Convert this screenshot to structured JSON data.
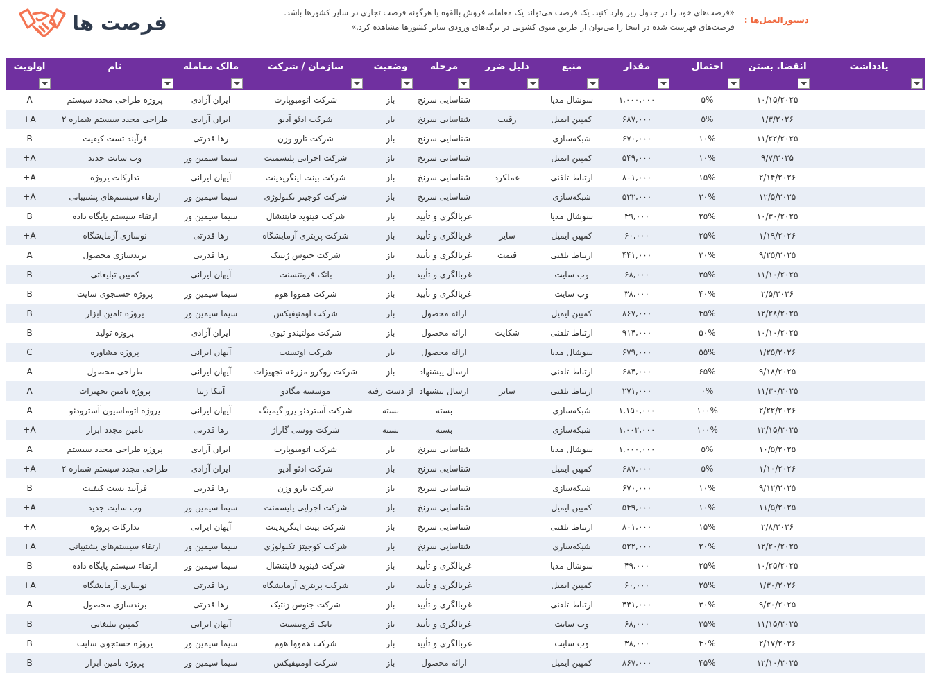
{
  "header": {
    "title": "فرصت ها",
    "instructions_label": "دستورالعمل‌ها :",
    "instruction_lines": [
      "«فرصت‌های خود را در جدول زیر وارد کنید. یک فرصت می‌تواند یک معامله، فروش بالقوه یا هرگونه فرصت تجاری در سایر کشورها باشد.",
      "فرصت‌های فهرست شده در اینجا را می‌توان از طریق منوی کشویی در برگه‌های ورودی سایر کشورها مشاهده کرد.»"
    ]
  },
  "table": {
    "columns": [
      {
        "label": "یادداشت"
      },
      {
        "label": "انقضا. بستن"
      },
      {
        "label": "احتمال"
      },
      {
        "label": "مقدار"
      },
      {
        "label": "منبع"
      },
      {
        "label": "دلیل ضرر"
      },
      {
        "label": "مرحله"
      },
      {
        "label": "وضعیت"
      },
      {
        "label": "سازمان / شرکت"
      },
      {
        "label": "مالک معامله"
      },
      {
        "label": "نام"
      },
      {
        "label": "اولویت"
      }
    ],
    "rows": [
      {
        "close_date": "۱۰/۱۵/۲۰۲۵",
        "probability": "۵%",
        "amount": "۱,۰۰۰,۰۰۰",
        "source": "سوشال مدیا",
        "stage": "شناسایی سرنخ",
        "status": "باز",
        "organization": "شرکت اتومبوپارت",
        "owner": "ایران آزادی",
        "name": "پروژه طراحی مجدد سیستم",
        "priority": "A"
      },
      {
        "close_date": "۱/۳/۲۰۲۶",
        "probability": "۵%",
        "amount": "۶۸۷,۰۰۰",
        "source": "کمپین ایمیل",
        "loss_reason": "رقیب",
        "stage": "شناسایی سرنخ",
        "status": "باز",
        "organization": "شرکت ادئو آدیو",
        "owner": "ایران آزادی",
        "name": "طراحی مجدد سیستم شماره ۲",
        "priority": "A+"
      },
      {
        "close_date": "۱۱/۲۲/۲۰۲۵",
        "probability": "۱۰%",
        "amount": "۶۷۰,۰۰۰",
        "source": "شبکه‌سازی",
        "stage": "شناسایی سرنخ",
        "status": "باز",
        "organization": "شرکت تارو وزن",
        "owner": "رها قدرتی",
        "name": "فرآیند تست کیفیت",
        "priority": "B"
      },
      {
        "close_date": "۹/۷/۲۰۲۵",
        "probability": "۱۰%",
        "amount": "۵۴۹,۰۰۰",
        "source": "کمپین ایمیل",
        "stage": "شناسایی سرنخ",
        "status": "باز",
        "organization": "شرکت اجرایی پلیسمنت",
        "owner": "سیما سیمین ور",
        "name": "وب سایت جدید",
        "priority": "A+"
      },
      {
        "close_date": "۲/۱۴/۲۰۲۶",
        "probability": "۱۵%",
        "amount": "۸۰۱,۰۰۰",
        "source": "ارتباط تلفنی",
        "loss_reason": "عملکرد",
        "stage": "شناسایی سرنخ",
        "status": "باز",
        "organization": "شرکت بینت اینگریدینت",
        "owner": "آیهان ایرانی",
        "name": "تدارکات پروژه",
        "priority": "A+"
      },
      {
        "close_date": "۱۲/۵/۲۰۲۵",
        "probability": "۲۰%",
        "amount": "۵۲۲,۰۰۰",
        "source": "شبکه‌سازی",
        "stage": "شناسایی سرنخ",
        "status": "باز",
        "organization": "شرکت کوجیتز تکنولوژی",
        "owner": "سیما سیمین ور",
        "name": "ارتقاء سیستم‌های پشتیبانی",
        "priority": "A+"
      },
      {
        "close_date": "۱۰/۳۰/۲۰۲۵",
        "probability": "۲۵%",
        "amount": "۴۹,۰۰۰",
        "source": "سوشال مدیا",
        "stage": "غربالگری و تأیید",
        "status": "باز",
        "organization": "شرکت فینوید فایننشال",
        "owner": "سیما سیمین ور",
        "name": "ارتقاء سیستم پایگاه داده",
        "priority": "B"
      },
      {
        "close_date": "۱/۱۹/۲۰۲۶",
        "probability": "۲۵%",
        "amount": "۶۰,۰۰۰",
        "source": "کمپین ایمیل",
        "loss_reason": "سایر",
        "stage": "غربالگری و تأیید",
        "status": "باز",
        "organization": "شرکت پریتری آزمایشگاه",
        "owner": "رها قدرتی",
        "name": "نوسازی آزمایشگاه",
        "priority": "A+"
      },
      {
        "close_date": "۹/۲۵/۲۰۲۵",
        "probability": "۳۰%",
        "amount": "۴۴۱,۰۰۰",
        "source": "ارتباط تلفنی",
        "loss_reason": "قیمت",
        "stage": "غربالگری و تأیید",
        "status": "باز",
        "organization": "شرکت جنوس ژنتیک",
        "owner": "رها قدرتی",
        "name": "برندسازی محصول",
        "priority": "A"
      },
      {
        "close_date": "۱۱/۱۰/۲۰۲۵",
        "probability": "۳۵%",
        "amount": "۶۸,۰۰۰",
        "source": "وب سایت",
        "stage": "غربالگری و تأیید",
        "status": "باز",
        "organization": "بانک فرونتسنت",
        "owner": "آیهان ایرانی",
        "name": "کمپین تبلیغاتی",
        "priority": "B"
      },
      {
        "close_date": "۲/۵/۲۰۲۶",
        "probability": "۴۰%",
        "amount": "۳۸,۰۰۰",
        "source": "وب سایت",
        "stage": "غربالگری و تأیید",
        "status": "باز",
        "organization": "شرکت همووا هوم",
        "owner": "سیما سیمین ور",
        "name": "پروژه جستجوی سایت",
        "priority": "B"
      },
      {
        "close_date": "۱۲/۲۸/۲۰۲۵",
        "probability": "۴۵%",
        "amount": "۸۶۷,۰۰۰",
        "source": "کمپین ایمیل",
        "stage": "ارائه محصول",
        "status": "باز",
        "organization": "شرکت اومنیفیکس",
        "owner": "سیما سیمین ور",
        "name": "پروژه تامین ابزار",
        "priority": "B"
      },
      {
        "close_date": "۱۰/۱۰/۲۰۲۵",
        "probability": "۵۰%",
        "amount": "۹۱۴,۰۰۰",
        "source": "ارتباط تلفنی",
        "loss_reason": "شکایت",
        "stage": "ارائه محصول",
        "status": "باز",
        "organization": "شرکت مولتیندو تیوی",
        "owner": "ایران آزادی",
        "name": "پروژه تولید",
        "priority": "B"
      },
      {
        "close_date": "۱/۲۵/۲۰۲۶",
        "probability": "۵۵%",
        "amount": "۶۷۹,۰۰۰",
        "source": "سوشال مدیا",
        "stage": "ارائه محصول",
        "status": "باز",
        "organization": "شرکت اوتسنت",
        "owner": "آیهان ایرانی",
        "name": "پروژه مشاوره",
        "priority": "C"
      },
      {
        "close_date": "۹/۱۸/۲۰۲۵",
        "probability": "۶۵%",
        "amount": "۶۸۴,۰۰۰",
        "source": "ارتباط تلفنی",
        "stage": "ارسال پیشنهاد",
        "status": "باز",
        "organization": "شرکت روکرو مزرعه تجهیزات",
        "owner": "آیهان ایرانی",
        "name": "طراحی محصول",
        "priority": "A"
      },
      {
        "close_date": "۱۱/۳۰/۲۰۲۵",
        "probability": "۰%",
        "amount": "۲۷۱,۰۰۰",
        "source": "ارتباط تلفنی",
        "loss_reason": "سایر",
        "stage": "ارسال پیشنهاد",
        "status": "از دست رفته",
        "organization": "موسسه مگادو",
        "owner": "آنیکا زیبا",
        "name": "پروژه تامین تجهیزات",
        "priority": "A"
      },
      {
        "close_date": "۲/۲۲/۲۰۲۶",
        "probability": "۱۰۰%",
        "amount": "۱,۱۵۰,۰۰۰",
        "source": "شبکه‌سازی",
        "stage": "بسته",
        "status": "بسته",
        "organization": "شرکت آستردئو پرو گیمینگ",
        "owner": "آیهان ایرانی",
        "name": "پروژه اتوماسیون آسترودئو",
        "priority": "A"
      },
      {
        "close_date": "۱۲/۱۵/۲۰۲۵",
        "probability": "۱۰۰%",
        "amount": "۱,۰۰۲,۰۰۰",
        "source": "شبکه‌سازی",
        "stage": "بسته",
        "status": "بسته",
        "organization": "شرکت ووسی گاراژ",
        "owner": "رها قدرتی",
        "name": "تامین مجدد ابزار",
        "priority": "A+"
      },
      {
        "close_date": "۱۰/۵/۲۰۲۵",
        "probability": "۵%",
        "amount": "۱,۰۰۰,۰۰۰",
        "source": "سوشال مدیا",
        "stage": "شناسایی سرنخ",
        "status": "باز",
        "organization": "شرکت اتومبوپارت",
        "owner": "ایران آزادی",
        "name": "پروژه طراحی مجدد سیستم",
        "priority": "A"
      },
      {
        "close_date": "۱/۱۰/۲۰۲۶",
        "probability": "۵%",
        "amount": "۶۸۷,۰۰۰",
        "source": "کمپین ایمیل",
        "stage": "شناسایی سرنخ",
        "status": "باز",
        "organization": "شرکت ادئو آدیو",
        "owner": "ایران آزادی",
        "name": "طراحی مجدد سیستم شماره ۲",
        "priority": "A+"
      },
      {
        "close_date": "۹/۱۲/۲۰۲۵",
        "probability": "۱۰%",
        "amount": "۶۷۰,۰۰۰",
        "source": "شبکه‌سازی",
        "stage": "شناسایی سرنخ",
        "status": "باز",
        "organization": "شرکت تارو وزن",
        "owner": "رها قدرتی",
        "name": "فرآیند تست کیفیت",
        "priority": "B"
      },
      {
        "close_date": "۱۱/۵/۲۰۲۵",
        "probability": "۱۰%",
        "amount": "۵۴۹,۰۰۰",
        "source": "کمپین ایمیل",
        "stage": "شناسایی سرنخ",
        "status": "باز",
        "organization": "شرکت اجرایی پلیسمنت",
        "owner": "سیما سیمین ور",
        "name": "وب سایت جدید",
        "priority": "A+"
      },
      {
        "close_date": "۲/۸/۲۰۲۶",
        "probability": "۱۵%",
        "amount": "۸۰۱,۰۰۰",
        "source": "ارتباط تلفنی",
        "stage": "شناسایی سرنخ",
        "status": "باز",
        "organization": "شرکت بینت اینگریدینت",
        "owner": "آیهان ایرانی",
        "name": "تدارکات پروژه",
        "priority": "A+"
      },
      {
        "close_date": "۱۲/۲۰/۲۰۲۵",
        "probability": "۲۰%",
        "amount": "۵۲۲,۰۰۰",
        "source": "شبکه‌سازی",
        "stage": "شناسایی سرنخ",
        "status": "باز",
        "organization": "شرکت کوجیتز تکنولوژی",
        "owner": "سیما سیمین ور",
        "name": "ارتقاء سیستم‌های پشتیبانی",
        "priority": "A+"
      },
      {
        "close_date": "۱۰/۲۵/۲۰۲۵",
        "probability": "۲۵%",
        "amount": "۴۹,۰۰۰",
        "source": "سوشال مدیا",
        "stage": "غربالگری و تأیید",
        "status": "باز",
        "organization": "شرکت فینوید فایننشال",
        "owner": "سیما سیمین ور",
        "name": "ارتقاء سیستم پایگاه داده",
        "priority": "B"
      },
      {
        "close_date": "۱/۳۰/۲۰۲۶",
        "probability": "۲۵%",
        "amount": "۶۰,۰۰۰",
        "source": "کمپین ایمیل",
        "stage": "غربالگری و تأیید",
        "status": "باز",
        "organization": "شرکت پریتری آزمایشگاه",
        "owner": "رها قدرتی",
        "name": "نوسازی آزمایشگاه",
        "priority": "A+"
      },
      {
        "close_date": "۹/۳۰/۲۰۲۵",
        "probability": "۳۰%",
        "amount": "۴۴۱,۰۰۰",
        "source": "ارتباط تلفنی",
        "stage": "غربالگری و تأیید",
        "status": "باز",
        "organization": "شرکت جنوس ژنتیک",
        "owner": "رها قدرتی",
        "name": "برندسازی محصول",
        "priority": "A"
      },
      {
        "close_date": "۱۱/۱۵/۲۰۲۵",
        "probability": "۳۵%",
        "amount": "۶۸,۰۰۰",
        "source": "وب سایت",
        "stage": "غربالگری و تأیید",
        "status": "باز",
        "organization": "بانک فرونتسنت",
        "owner": "آیهان ایرانی",
        "name": "کمپین تبلیغاتی",
        "priority": "B"
      },
      {
        "close_date": "۲/۱۷/۲۰۲۶",
        "probability": "۴۰%",
        "amount": "۳۸,۰۰۰",
        "source": "وب سایت",
        "stage": "غربالگری و تأیید",
        "status": "باز",
        "organization": "شرکت همووا هوم",
        "owner": "سیما سیمین ور",
        "name": "پروژه جستجوی سایت",
        "priority": "B"
      },
      {
        "close_date": "۱۲/۱۰/۲۰۲۵",
        "probability": "۴۵%",
        "amount": "۸۶۷,۰۰۰",
        "source": "کمپین ایمیل",
        "stage": "ارائه محصول",
        "status": "باز",
        "organization": "شرکت اومنیفیکس",
        "owner": "سیما سیمین ور",
        "name": "پروژه تامین ابزار",
        "priority": "B"
      }
    ]
  }
}
